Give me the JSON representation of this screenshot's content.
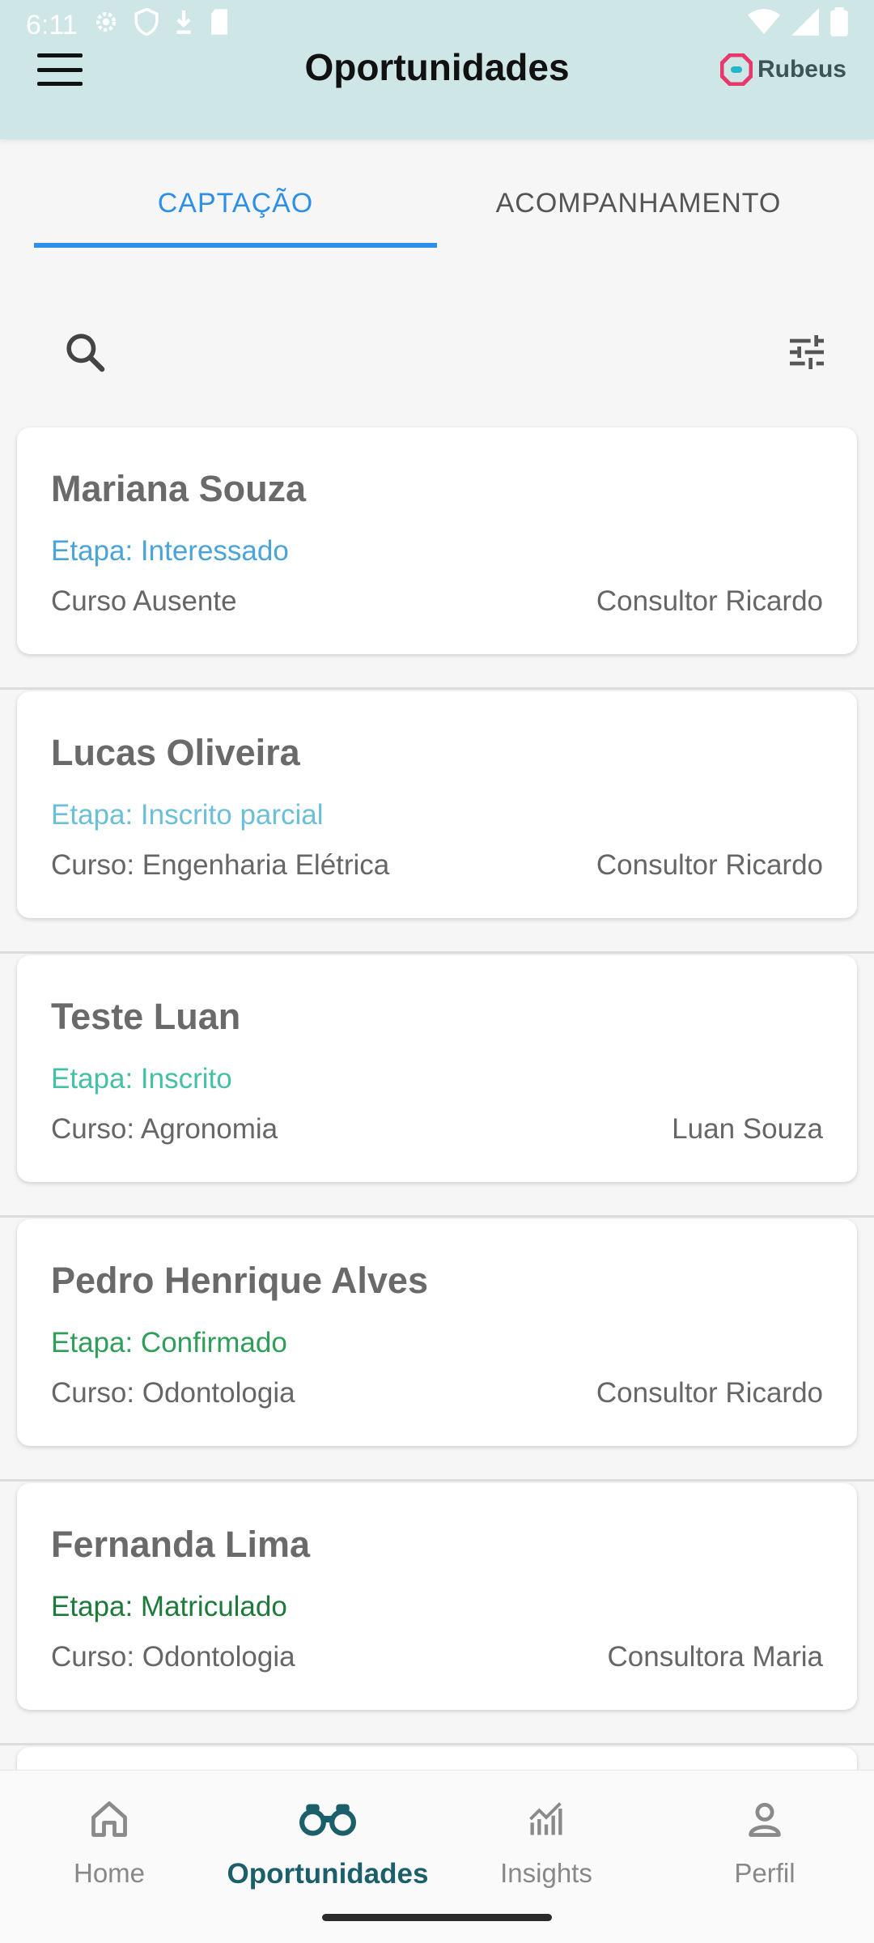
{
  "status_bar": {
    "time": "6:11"
  },
  "header": {
    "title": "Oportunidades",
    "logo_text": "Rubeus"
  },
  "tabs": [
    {
      "label": "CAPTAÇÃO",
      "active": true
    },
    {
      "label": "ACOMPANHAMENTO",
      "active": false
    }
  ],
  "toolbar": {
    "search_icon": "search-icon",
    "filter_icon": "tune-icon"
  },
  "cards": [
    {
      "name": "Mariana Souza",
      "stage": "Etapa: Interessado",
      "stage_color": "#4aa3d9",
      "course": "Curso Ausente",
      "consultant": "Consultor Ricardo"
    },
    {
      "name": "Lucas Oliveira",
      "stage": "Etapa: Inscrito parcial",
      "stage_color": "#6bbfd6",
      "course": "Curso: Engenharia Elétrica",
      "consultant": "Consultor Ricardo"
    },
    {
      "name": "Teste Luan",
      "stage": "Etapa: Inscrito",
      "stage_color": "#45bfa6",
      "course": "Curso: Agronomia",
      "consultant": "Luan Souza"
    },
    {
      "name": "Pedro Henrique Alves",
      "stage": "Etapa: Confirmado",
      "stage_color": "#2e9e58",
      "course": "Curso: Odontologia",
      "consultant": "Consultor Ricardo"
    },
    {
      "name": "Fernanda Lima",
      "stage": "Etapa: Matriculado",
      "stage_color": "#1d7a3a",
      "course": "Curso: Odontologia",
      "consultant": "Consultora Maria"
    }
  ],
  "bottom_nav": [
    {
      "label": "Home",
      "icon": "home-icon",
      "active": false
    },
    {
      "label": "Oportunidades",
      "icon": "binoculars-icon",
      "active": true
    },
    {
      "label": "Insights",
      "icon": "chart-icon",
      "active": false
    },
    {
      "label": "Perfil",
      "icon": "person-icon",
      "active": false
    }
  ],
  "colors": {
    "accent": "#2e8fe8",
    "header_bg": "#cfe6e6",
    "nav_active": "#1b5f6a"
  }
}
